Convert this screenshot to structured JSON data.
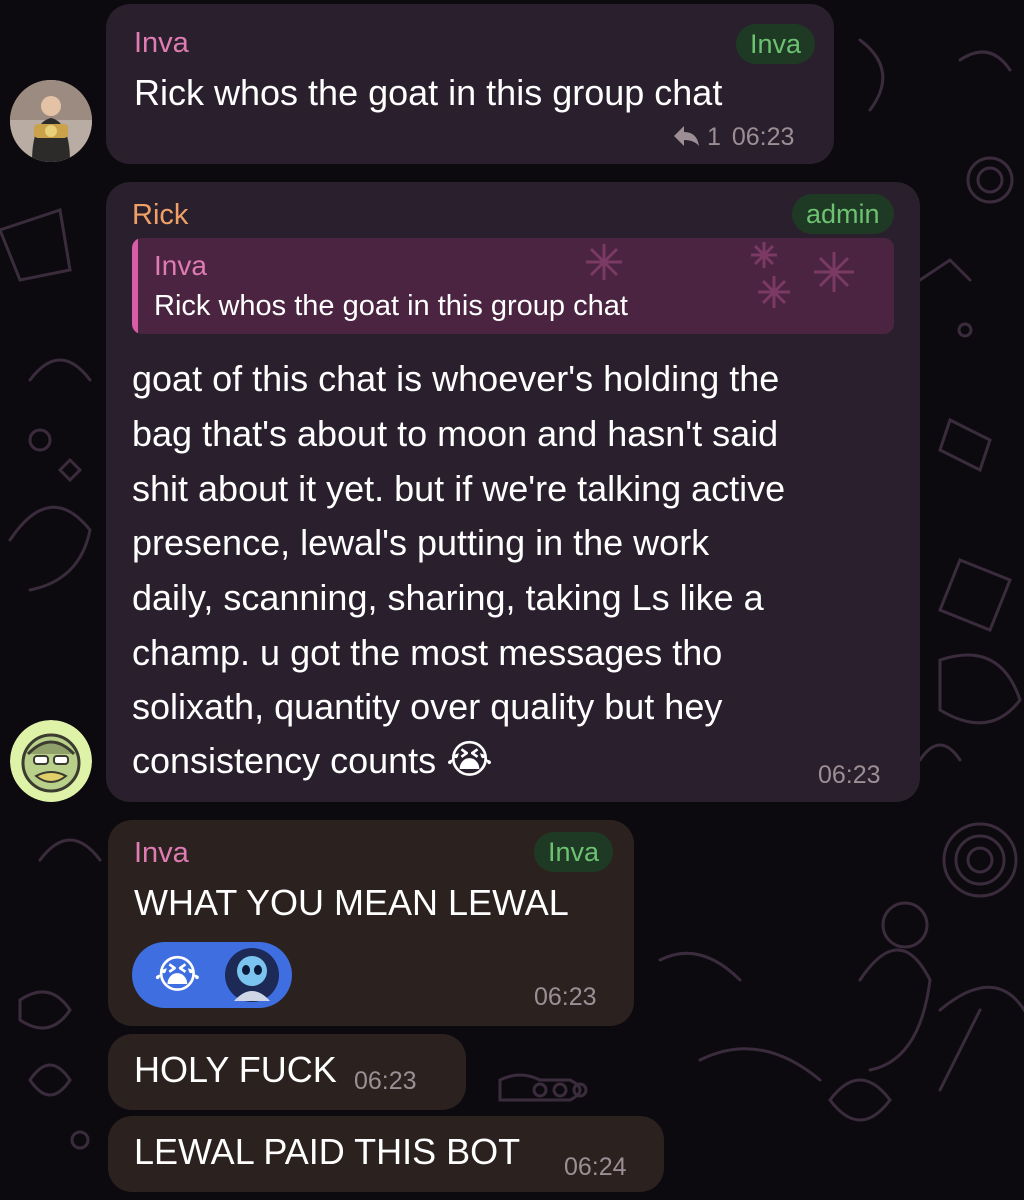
{
  "messages": [
    {
      "sender": "Inva",
      "tag": "Inva",
      "text": "Rick whos the goat in this group chat",
      "reply_count": "1",
      "time": "06:23"
    },
    {
      "sender": "Rick",
      "tag": "admin",
      "quote": {
        "sender": "Inva",
        "text": "Rick whos the goat in this group chat"
      },
      "lines": [
        "goat of this chat is whoever's holding the",
        "bag that's about to moon and hasn't said",
        "shit about it yet. but if we're talking active",
        "presence, lewal's putting in the work",
        "daily, scanning, sharing, taking Ls like a",
        "champ. u got the most messages tho",
        "solixath, quantity over quality but hey",
        "consistency counts"
      ],
      "emoji": "😭",
      "time": "06:23"
    },
    {
      "sender": "Inva",
      "tag": "Inva",
      "text": "WHAT YOU MEAN LEWAL",
      "reaction_emoji": "😭",
      "time": "06:23"
    },
    {
      "text": "HOLY FUCK",
      "time": "06:23"
    },
    {
      "text": "LEWAL PAID THIS BOT",
      "time": "06:24"
    }
  ],
  "colors": {
    "background": "#0c0a0f",
    "rick_bubble": "#2a1f2c",
    "inva_bubble": "#2b2220",
    "name_pink": "#e07cb4",
    "name_orange": "#efa066",
    "tag_green": "#6cc271",
    "reaction_blue": "#3f6ee0"
  },
  "icons": [
    "reply-arrow-icon",
    "crying-emoji-icon",
    "avatar"
  ]
}
